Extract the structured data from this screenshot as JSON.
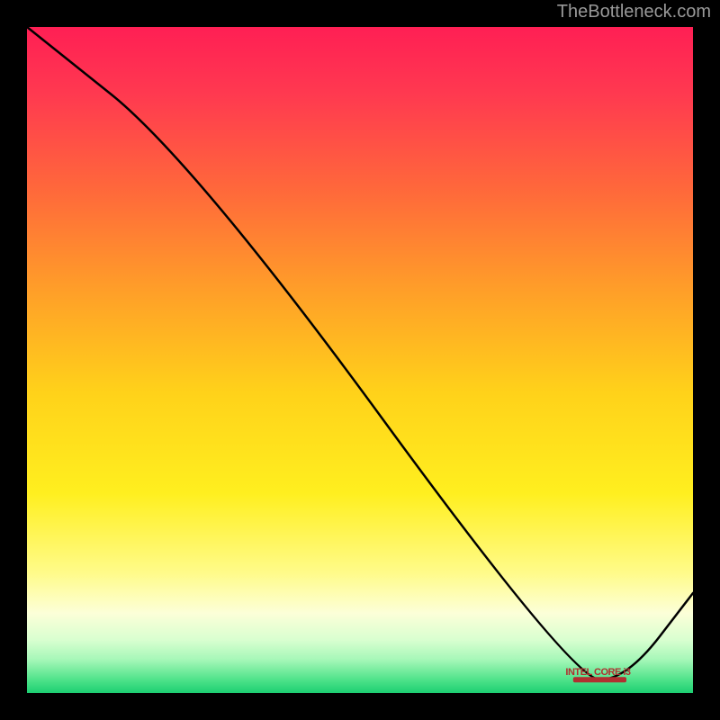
{
  "attribution": "TheBottleneck.com",
  "marker_label": "INTEL CORE i3",
  "chart_data": {
    "type": "line",
    "title": "",
    "xlabel": "",
    "ylabel": "",
    "xlim": [
      0,
      100
    ],
    "ylim": [
      0,
      100
    ],
    "grid": false,
    "legend": false,
    "series": [
      {
        "name": "curve",
        "x": [
          0,
          25,
          82,
          90,
          100
        ],
        "values": [
          100,
          80,
          2,
          2,
          15
        ]
      }
    ],
    "marker": {
      "x_range": [
        82,
        90
      ],
      "y": 2
    },
    "background_gradient_stops": [
      {
        "offset": 0.0,
        "color": "#ff1f54"
      },
      {
        "offset": 0.1,
        "color": "#ff3950"
      },
      {
        "offset": 0.25,
        "color": "#ff6a3a"
      },
      {
        "offset": 0.4,
        "color": "#ffa028"
      },
      {
        "offset": 0.55,
        "color": "#ffd21a"
      },
      {
        "offset": 0.7,
        "color": "#ffef1f"
      },
      {
        "offset": 0.82,
        "color": "#fffb8a"
      },
      {
        "offset": 0.88,
        "color": "#fcffd8"
      },
      {
        "offset": 0.92,
        "color": "#d9ffd0"
      },
      {
        "offset": 0.95,
        "color": "#a6f7b8"
      },
      {
        "offset": 0.98,
        "color": "#4fe38a"
      },
      {
        "offset": 1.0,
        "color": "#1ccf72"
      }
    ]
  }
}
